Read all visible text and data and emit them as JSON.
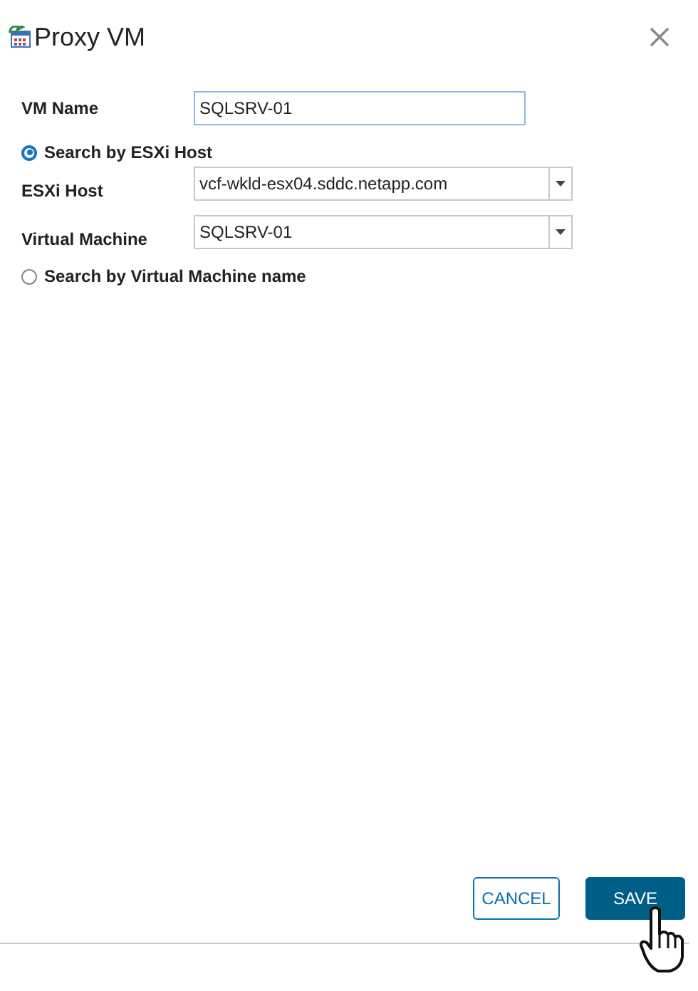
{
  "dialog": {
    "title": "Proxy VM"
  },
  "vm_name": {
    "label": "VM Name",
    "value": "SQLSRV-01"
  },
  "search_modes": [
    {
      "label": "Search by ESXi Host",
      "selected": true,
      "fields": [
        {
          "label": "ESXi Host",
          "value": "vcf-wkld-esx04.sddc.netapp.com"
        },
        {
          "label": "Virtual Machine",
          "value": "SQLSRV-01"
        }
      ]
    },
    {
      "label": "Search by Virtual Machine name",
      "selected": false
    }
  ],
  "buttons": [
    {
      "label": "CANCEL",
      "kind": "secondary"
    },
    {
      "label": "SAVE",
      "kind": "primary"
    }
  ]
}
